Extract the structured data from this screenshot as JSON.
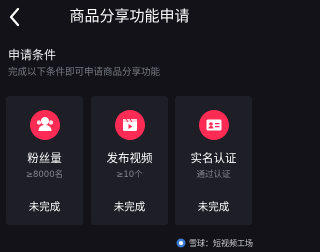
{
  "header": {
    "title": "商品分享功能申请",
    "back_icon": "chevron-left-icon"
  },
  "section": {
    "title": "申请条件",
    "subtitle": "完成以下条件即可申请商品分享功能"
  },
  "cards": [
    {
      "label": "粉丝量",
      "requirement": "≥8000名",
      "status": "未完成",
      "icon": "fans-icon"
    },
    {
      "label": "发布视频",
      "requirement": "≥10个",
      "status": "未完成",
      "icon": "video-icon"
    },
    {
      "label": "实名认证",
      "requirement": "通过认证",
      "status": "未完成",
      "icon": "id-card-icon"
    }
  ],
  "watermark": {
    "logo": "snowball-logo",
    "text": "雪球：短视频工场"
  },
  "colors": {
    "background": "#121218",
    "card": "#1e1e27",
    "accent": "#fe2c55",
    "muted_text": "#7b7b86"
  }
}
